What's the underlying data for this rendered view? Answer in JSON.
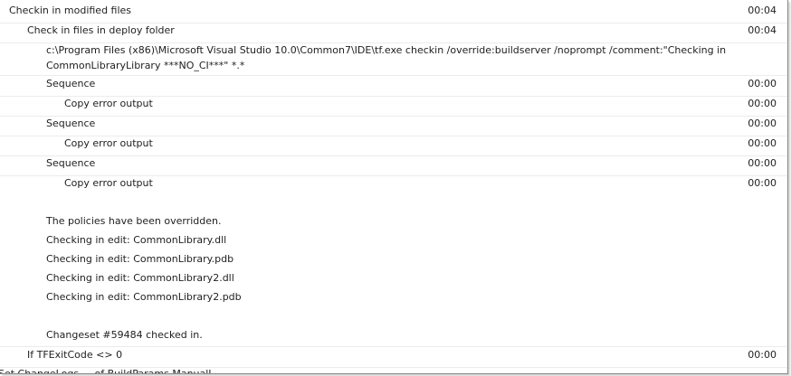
{
  "rows": {
    "checkin_modified": {
      "label": "Checkin in modified files",
      "time": "00:04"
    },
    "checkin_deploy": {
      "label": "Check in files in deploy folder",
      "time": "00:04"
    },
    "command": {
      "text": "c:\\Program Files (x86)\\Microsoft Visual Studio 10.0\\Common7\\IDE\\tf.exe checkin /override:buildserver /noprompt /comment:\"Checking in CommonLibraryLibrary ***NO_CI***\" *.*"
    },
    "seq1": {
      "label": "Sequence",
      "time": "00:00"
    },
    "copy1": {
      "label": "Copy error output",
      "time": "00:00"
    },
    "seq2": {
      "label": "Sequence",
      "time": "00:00"
    },
    "copy2": {
      "label": "Copy error output",
      "time": "00:00"
    },
    "seq3": {
      "label": "Sequence",
      "time": "00:00"
    },
    "copy3": {
      "label": "Copy error output",
      "time": "00:00"
    },
    "policies": {
      "text": "The policies have been overridden."
    },
    "edit1": {
      "text": "Checking in edit: CommonLibrary.dll"
    },
    "edit2": {
      "text": "Checking in edit: CommonLibrary.pdb"
    },
    "edit3": {
      "text": "Checking in edit: CommonLibrary2.dll"
    },
    "edit4": {
      "text": "Checking in edit: CommonLibrary2.pdb"
    },
    "changeset": {
      "text": "Changeset #59484 checked in."
    },
    "if_exit": {
      "label": "If TFExitCode <> 0",
      "time": "00:00"
    },
    "cutoff": {
      "text": "Set ChangeLogs ... of BuildParams ManualL..."
    }
  }
}
